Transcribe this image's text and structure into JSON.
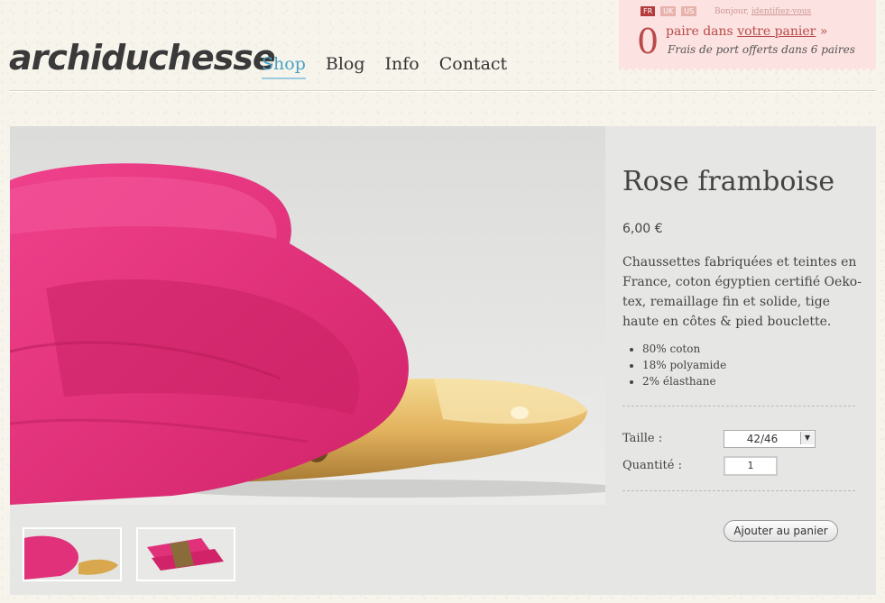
{
  "header": {
    "logo_text": "archiduchesse",
    "nav": [
      {
        "label": "Shop",
        "active": true
      },
      {
        "label": "Blog",
        "active": false
      },
      {
        "label": "Info",
        "active": false
      },
      {
        "label": "Contact",
        "active": false
      }
    ]
  },
  "cart": {
    "languages": [
      "FR",
      "UK",
      "US"
    ],
    "active_language": "FR",
    "greeting": "Bonjour,",
    "login_link": "identifiez-vous",
    "count": "0",
    "line1_text": "paire dans",
    "cart_link": "votre panier",
    "cart_arrow": "»",
    "shipping_note": "Frais de port offerts dans 6 paires"
  },
  "product": {
    "title": "Rose framboise",
    "price": "6,00 €",
    "description": "Chaussettes fabriquées et teintes en France, coton égyptien certifié Oeko-tex, remaillage fin et solide, tige haute en côtes & pied bouclette.",
    "composition": [
      "80% coton",
      "18% polyamide",
      "2% élasthane"
    ],
    "size_label": "Taille :",
    "size_value": "42/46",
    "quantity_label": "Quantité :",
    "quantity_value": "1",
    "add_button": "Ajouter au panier"
  },
  "colors": {
    "accent": "#4aa3c7",
    "sock_pink": "#e0317a",
    "cart_bg": "#fce2e0",
    "cart_text": "#b84a4a"
  }
}
